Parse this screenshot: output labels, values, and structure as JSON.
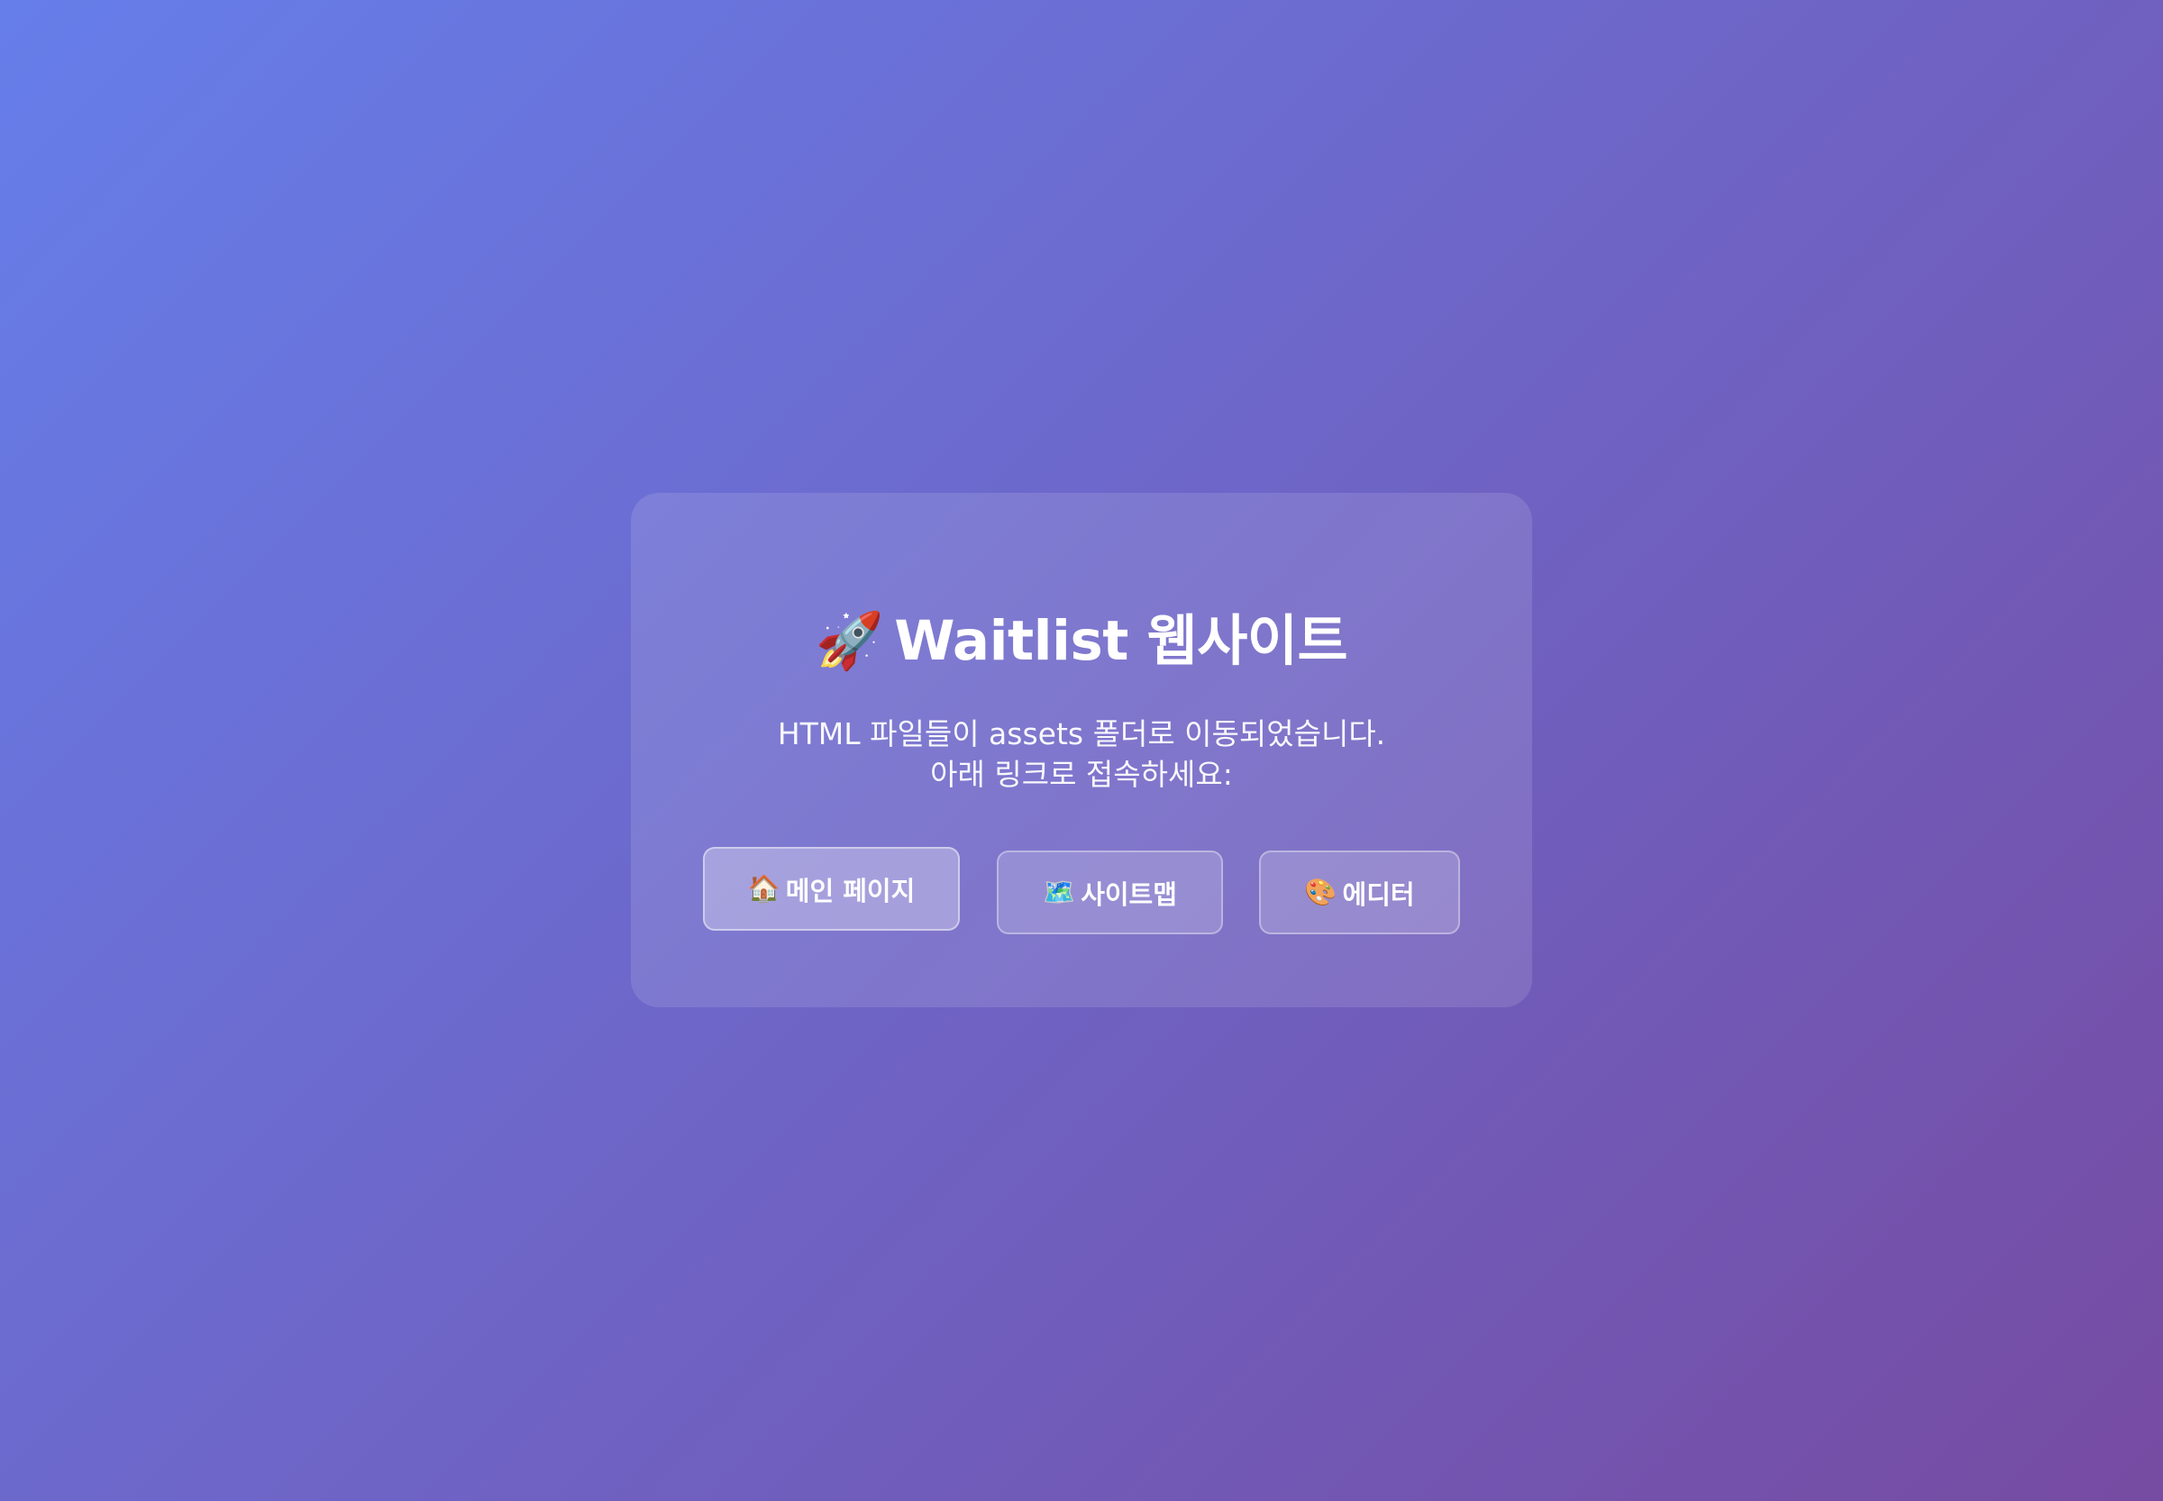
{
  "card": {
    "title_icon": "🚀",
    "title": "Waitlist 웹사이트",
    "description_line1": "HTML 파일들이 assets 폴더로 이동되었습니다.",
    "description_line2": "아래 링크로 접속하세요:"
  },
  "buttons": [
    {
      "icon": "🏠",
      "icon_name": "house-icon",
      "label": "메인 페이지"
    },
    {
      "icon": "🗺️",
      "icon_name": "map-icon",
      "label": "사이트맵"
    },
    {
      "icon": "🎨",
      "icon_name": "palette-icon",
      "label": "에디터"
    }
  ],
  "colors": {
    "gradient_start": "#667eea",
    "gradient_end": "#764ba2",
    "text": "#ffffff"
  }
}
